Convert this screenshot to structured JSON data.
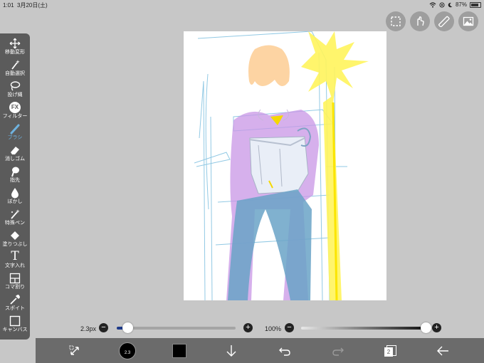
{
  "status_bar": {
    "time": "1:01",
    "date": "3月20日(土)",
    "battery": "87%",
    "battery_level": 0.87
  },
  "toolbar": {
    "tools": [
      {
        "label": "移動変形",
        "icon": "move-icon"
      },
      {
        "label": "自動選択",
        "icon": "magic-wand-icon"
      },
      {
        "label": "投げ縄",
        "icon": "lasso-icon"
      },
      {
        "label": "フィルター",
        "icon": "fx-icon",
        "glyph": "FX"
      },
      {
        "label": "ブラシ",
        "icon": "brush-icon",
        "active": true
      },
      {
        "label": "消しゴム",
        "icon": "eraser-icon"
      },
      {
        "label": "指先",
        "icon": "finger-icon"
      },
      {
        "label": "ぼかし",
        "icon": "blur-drop-icon"
      },
      {
        "label": "特殊ペン",
        "icon": "special-pen-icon"
      },
      {
        "label": "塗りつぶし",
        "icon": "fill-bucket-icon"
      },
      {
        "label": "文字入れ",
        "icon": "text-icon",
        "glyph": "T"
      },
      {
        "label": "コマ割り",
        "icon": "frame-divider-icon"
      },
      {
        "label": "スポイト",
        "icon": "eyedropper-icon"
      },
      {
        "label": "キャンバス",
        "icon": "canvas-icon"
      }
    ]
  },
  "brush": {
    "size_label": "2.3px",
    "size_fraction": 0.09,
    "opacity_label": "100%",
    "opacity_fraction": 1.0,
    "color_swatch_label": "2.3"
  },
  "colors": {
    "accent": "#6fb3e0",
    "toolbar_bg": "#5b5b5b",
    "bottom_bar_bg": "#6b6b6b",
    "current_color": "#000000"
  },
  "bottom_bar": {
    "layer_count": "2"
  }
}
